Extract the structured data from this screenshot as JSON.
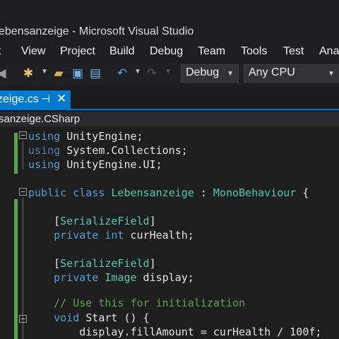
{
  "window": {
    "title": "ebensanzeige - Microsoft Visual Studio"
  },
  "menu": [
    "t",
    "View",
    "Project",
    "Build",
    "Debug",
    "Team",
    "Tools",
    "Test",
    "Ana"
  ],
  "toolbar": {
    "config_value": "Debug",
    "platform_value": "Any CPU"
  },
  "tab": {
    "name": "zeige.cs",
    "pin": "⊣",
    "close": "✕"
  },
  "navigation": {
    "scope": "sanzeige.CSharp"
  },
  "code": {
    "lines": [
      [
        {
          "t": "using ",
          "c": "kw"
        },
        {
          "t": "UnityEngine;",
          "c": "plain"
        }
      ],
      [
        {
          "t": "using ",
          "c": "kw-dim"
        },
        {
          "t": "System.Collections;",
          "c": "plain"
        }
      ],
      [
        {
          "t": "using ",
          "c": "kw"
        },
        {
          "t": "UnityEngine.UI;",
          "c": "plain"
        }
      ],
      [],
      [
        {
          "t": "public ",
          "c": "kw"
        },
        {
          "t": "class ",
          "c": "kw"
        },
        {
          "t": "Lebensanzeige",
          "c": "type"
        },
        {
          "t": " : ",
          "c": "plain"
        },
        {
          "t": "MonoBehaviour",
          "c": "type"
        },
        {
          "t": " {",
          "c": "plain"
        }
      ],
      [],
      [
        {
          "t": "    [",
          "c": "plain"
        },
        {
          "t": "SerializeField",
          "c": "type"
        },
        {
          "t": "]",
          "c": "plain"
        }
      ],
      [
        {
          "t": "    private ",
          "c": "kw"
        },
        {
          "t": "int ",
          "c": "kw"
        },
        {
          "t": "curHealth;",
          "c": "plain"
        }
      ],
      [],
      [
        {
          "t": "    [",
          "c": "plain"
        },
        {
          "t": "SerializeField",
          "c": "type"
        },
        {
          "t": "]",
          "c": "plain"
        }
      ],
      [
        {
          "t": "    private ",
          "c": "kw"
        },
        {
          "t": "Image",
          "c": "type"
        },
        {
          "t": " display;",
          "c": "plain"
        }
      ],
      [],
      [
        {
          "t": "    // Use this for initialization",
          "c": "comment"
        }
      ],
      [
        {
          "t": "    void ",
          "c": "kw"
        },
        {
          "t": "Start () {",
          "c": "plain"
        }
      ],
      [
        {
          "t": "        display.fillAmount = curHealth / 100f;",
          "c": "plain"
        }
      ]
    ]
  },
  "colors": {
    "accent": "#007acc",
    "change_bar": "#57a64a"
  },
  "icons": [
    "back-icon",
    "new-project-icon",
    "open-folder-icon",
    "save-icon",
    "save-all-icon",
    "undo-icon",
    "redo-icon"
  ]
}
